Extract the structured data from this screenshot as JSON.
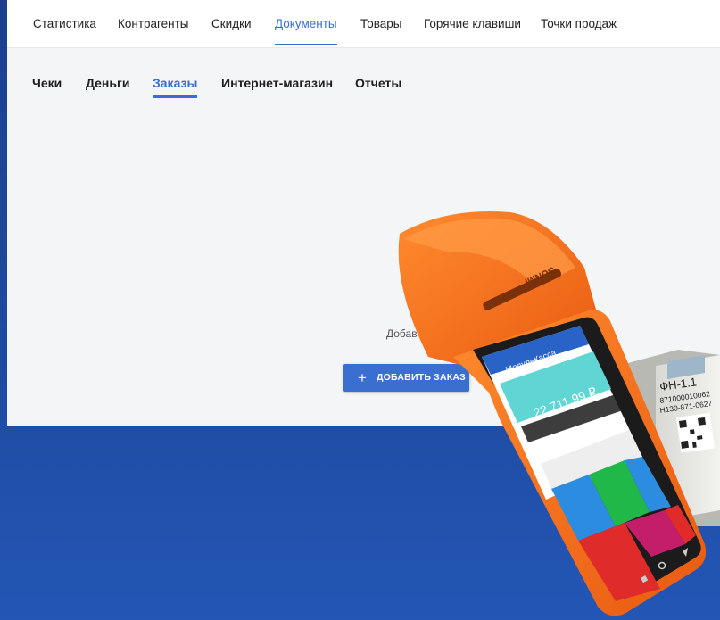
{
  "top_nav": {
    "items": [
      {
        "label": "Статистика"
      },
      {
        "label": "Контрагенты"
      },
      {
        "label": "Скидки"
      },
      {
        "label": "Документы"
      },
      {
        "label": "Товары"
      },
      {
        "label": "Горячие клавиши"
      },
      {
        "label": "Точки продаж"
      }
    ],
    "active": "Документы"
  },
  "sub_tabs": {
    "items": [
      {
        "label": "Чеки"
      },
      {
        "label": "Деньги"
      },
      {
        "label": "Заказы"
      },
      {
        "label": "Интернет-магазин"
      },
      {
        "label": "Отчеты"
      }
    ],
    "active": "Заказы"
  },
  "empty_state": {
    "text_fragment": "Добав",
    "add_button_label": "ДОБАВИТЬ ЗАКАЗ",
    "add_button_icon": "plus-icon"
  },
  "promo_terminal": {
    "brand": "SUNMI",
    "app_title": "МодульКасса",
    "total": "22 711.99 ₽",
    "fn_label": "ФН-1.1",
    "fn_serial_1": "871000010062",
    "fn_serial_2": "Н130-871-0627"
  },
  "colors": {
    "accent": "#3a6fd0",
    "background_blue": "#1e4aa0",
    "terminal_orange": "#f26a1b"
  }
}
